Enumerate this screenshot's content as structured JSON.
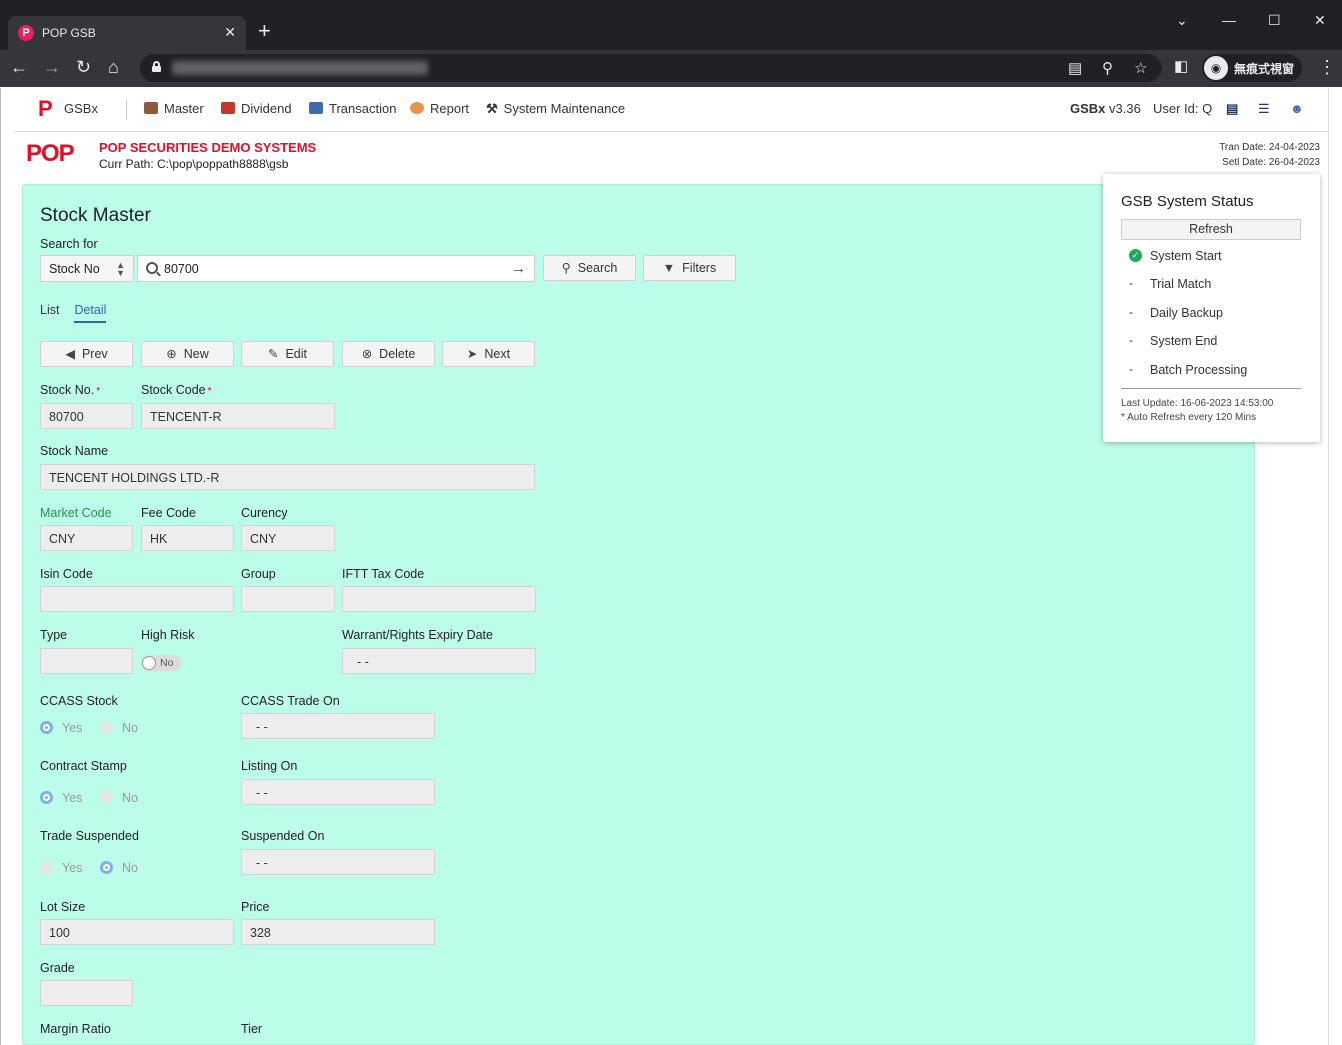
{
  "browser": {
    "tab_title": "POP GSB",
    "tab_close": "✕",
    "new_tab": "+",
    "profile_label": "無痕式視窗"
  },
  "nav": {
    "brand": "GSBx",
    "items": [
      "Master",
      "Dividend",
      "Transaction",
      "Report",
      "System Maintenance"
    ],
    "version_name": "GSBx",
    "version": "v3.36",
    "user": "User Id: Q"
  },
  "header": {
    "logo": "POP",
    "company": "POP SECURITIES DEMO SYSTEMS",
    "curr_path": "Curr Path: C:\\pop\\poppath8888\\gsb",
    "tran_date": "Tran Date: 24-04-2023",
    "setl_date": "Setl Date: 26-04-2023"
  },
  "page": {
    "title": "Stock Master",
    "search_for_label": "Search for",
    "search_field": "Stock No",
    "search_value": "80700",
    "search_button": "Search",
    "filters_button": "Filters",
    "tabs": [
      "List",
      "Detail"
    ],
    "buttons": {
      "prev": "Prev",
      "new": "New",
      "edit": "Edit",
      "delete": "Delete",
      "next": "Next"
    }
  },
  "form": {
    "stock_no_label": "Stock No.",
    "stock_no": "80700",
    "stock_code_label": "Stock Code",
    "stock_code": "TENCENT-R",
    "stock_name_label": "Stock Name",
    "stock_name": "TENCENT HOLDINGS LTD.-R",
    "market_code_label": "Market Code",
    "market_code": "CNY",
    "fee_code_label": "Fee Code",
    "fee_code": "HK",
    "currency_label": "Curency",
    "currency": "CNY",
    "isin_label": "Isin Code",
    "isin": "",
    "group_label": "Group",
    "group": "",
    "ifft_label": "IFTT Tax Code",
    "ifft": "",
    "type_label": "Type",
    "type": "",
    "high_risk_label": "High Risk",
    "high_risk": "No",
    "warrant_label": "Warrant/Rights Expiry Date",
    "warrant": "-  -",
    "ccass_label": "CCASS Stock",
    "ccass_trade_label": "CCASS Trade On",
    "ccass_trade": "-  -",
    "contract_label": "Contract Stamp",
    "listing_label": "Listing On",
    "listing": "-  -",
    "suspended_label": "Trade Suspended",
    "suspended_on_label": "Suspended On",
    "suspended_on": "-  -",
    "yes": "Yes",
    "no": "No",
    "lot_label": "Lot Size",
    "lot": "100",
    "price_label": "Price",
    "price": "328",
    "grade_label": "Grade",
    "grade": "",
    "margin_label": "Margin Ratio",
    "tier_label": "Tier"
  },
  "status": {
    "title": "GSB System Status",
    "refresh": "Refresh",
    "items": [
      "System Start",
      "Trial Match",
      "Daily Backup",
      "System End",
      "Batch Processing"
    ],
    "pending_mark": "-",
    "last_update": "Last Update: 16-06-2023 14:53:00",
    "auto_refresh": "* Auto Refresh every 120 Mins"
  },
  "colors": {
    "panel": "#bcfde9",
    "accent": "#2f64b3",
    "brand_red": "#e0102a",
    "check_green": "#22a85c"
  }
}
